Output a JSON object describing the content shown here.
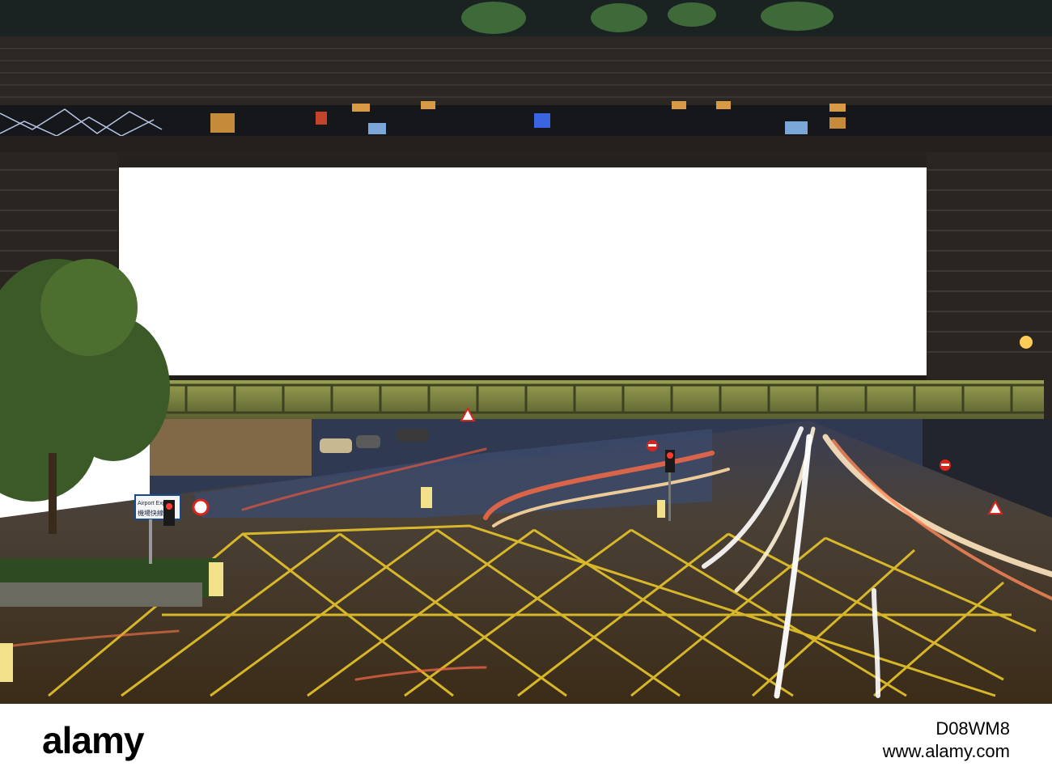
{
  "scene": {
    "billboard_text": "",
    "road_sign_text": "Airport Expr",
    "road_sign_subtext": "機場快線"
  },
  "footer": {
    "logo_text": "alamy",
    "image_id": "D08WM8",
    "site_url": "www.alamy.com"
  },
  "colors": {
    "sky_building": "#1c1a17",
    "billboard": "#ffffff",
    "bridge": "#6f7a3c",
    "road": "#4a3a22",
    "yellow_lines": "#e8c52a",
    "tree": "#3d5a2a"
  }
}
